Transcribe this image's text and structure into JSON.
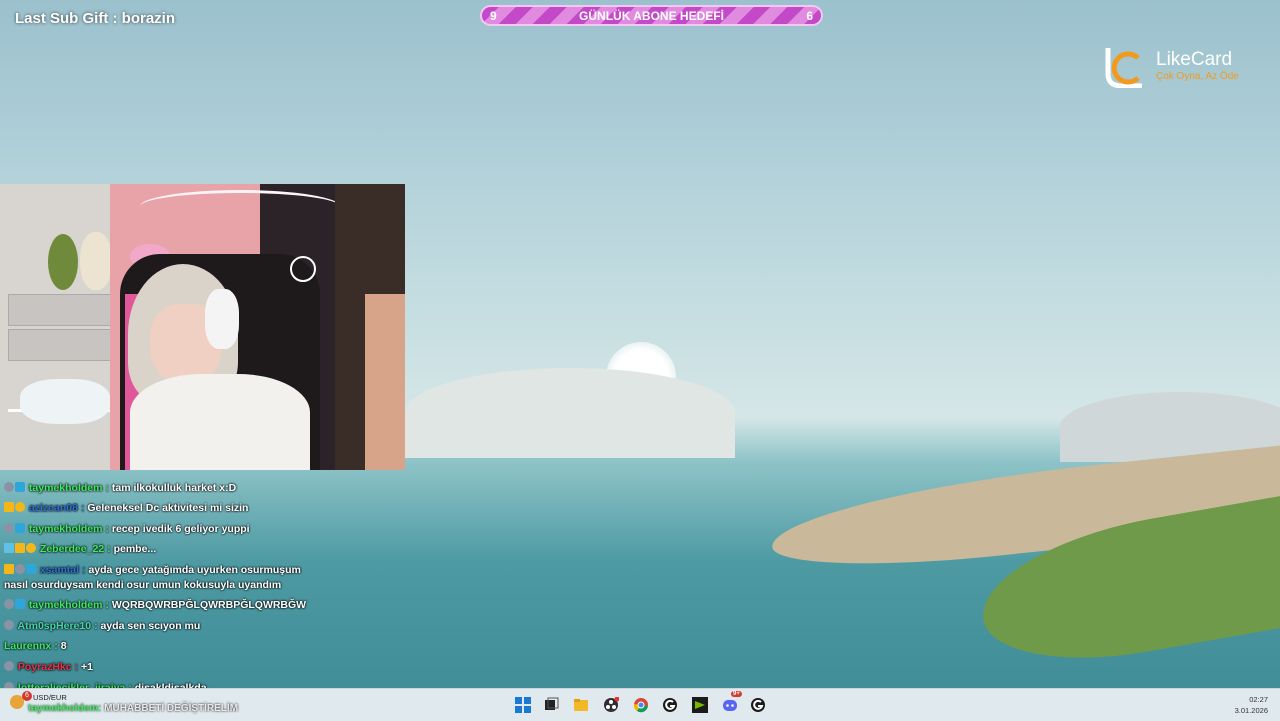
{
  "overlay": {
    "last_sub_gift": "Last Sub Gift : borazin",
    "goal": {
      "left_value": "9",
      "title": "GÜNLÜK ABONE HEDEFİ",
      "right_value": "6"
    },
    "logo": {
      "name": "LikeCard",
      "tagline": "Çok Oyna, Az Öde"
    }
  },
  "chat": {
    "messages": [
      {
        "badges": [
          "moon-icon",
          "cube-icon"
        ],
        "user": "taymekholdem",
        "user_color": "#3ee860",
        "text": "tam ilkokulluk harket x:D"
      },
      {
        "badges": [
          "crown-icon",
          "coin-icon"
        ],
        "user": "azizcan08",
        "user_color": "#2e6fd8",
        "text": "Geleneksel Dc aktivitesi mi sizin"
      },
      {
        "badges": [
          "moon-icon",
          "cube-icon"
        ],
        "user": "taymekholdem",
        "user_color": "#3ee860",
        "text": "recep ivedik 6 geliyor yuppi"
      },
      {
        "badges": [
          "sword-icon",
          "crown-icon",
          "coin-icon"
        ],
        "user": "Zeberdee_22",
        "user_color": "#3ee860",
        "text": "pembe..."
      },
      {
        "badges": [
          "crown-icon",
          "moon-icon",
          "cube-icon"
        ],
        "user": "xsamtal",
        "user_color": "#2e6fd8",
        "text": "ayda gece yatağımda uyurken osurmuşum",
        "text2": "nasıl osurduysam kendi osur umun kokusuyla uyandım"
      },
      {
        "badges": [
          "moon-icon",
          "cube-icon"
        ],
        "user": "taymekholdem",
        "user_color": "#3ee860",
        "text": "WQRBQWRBPĞLQWRBPĞLQWRBĞW"
      },
      {
        "badges": [
          "moon-icon"
        ],
        "user": "Atm0spHere10",
        "user_color": "#45d6a8",
        "text": "ayda sen scıyon mu"
      },
      {
        "badges": [],
        "user": "Laurennx",
        "user_color": "#3ee860",
        "text": "8"
      },
      {
        "badges": [
          "moon-icon"
        ],
        "user": "PoyrazHkc",
        "user_color": "#e8324a",
        "text": "+1"
      },
      {
        "badges": [
          "moon-icon"
        ],
        "user": "lotteraliecikler_jiraiya",
        "user_color": "#3ee860",
        "text": "djsakldjsalkda"
      }
    ]
  },
  "taskbar": {
    "ticker_badge": "6",
    "ticker_label": "USD/EUR",
    "reward": {
      "user": "taymekholdem",
      "text": "MUHABBETİ DEĞİŞTİRELİM"
    },
    "clock_time": "02:27",
    "clock_date": "3.01.2026",
    "apps": [
      "windows-start-icon",
      "task-view-icon",
      "file-explorer-icon",
      "obs-icon",
      "chrome-icon",
      "app-g-icon",
      "nvidia-icon",
      "discord-icon",
      "app-g2-icon"
    ],
    "discord_badge": "9+"
  }
}
